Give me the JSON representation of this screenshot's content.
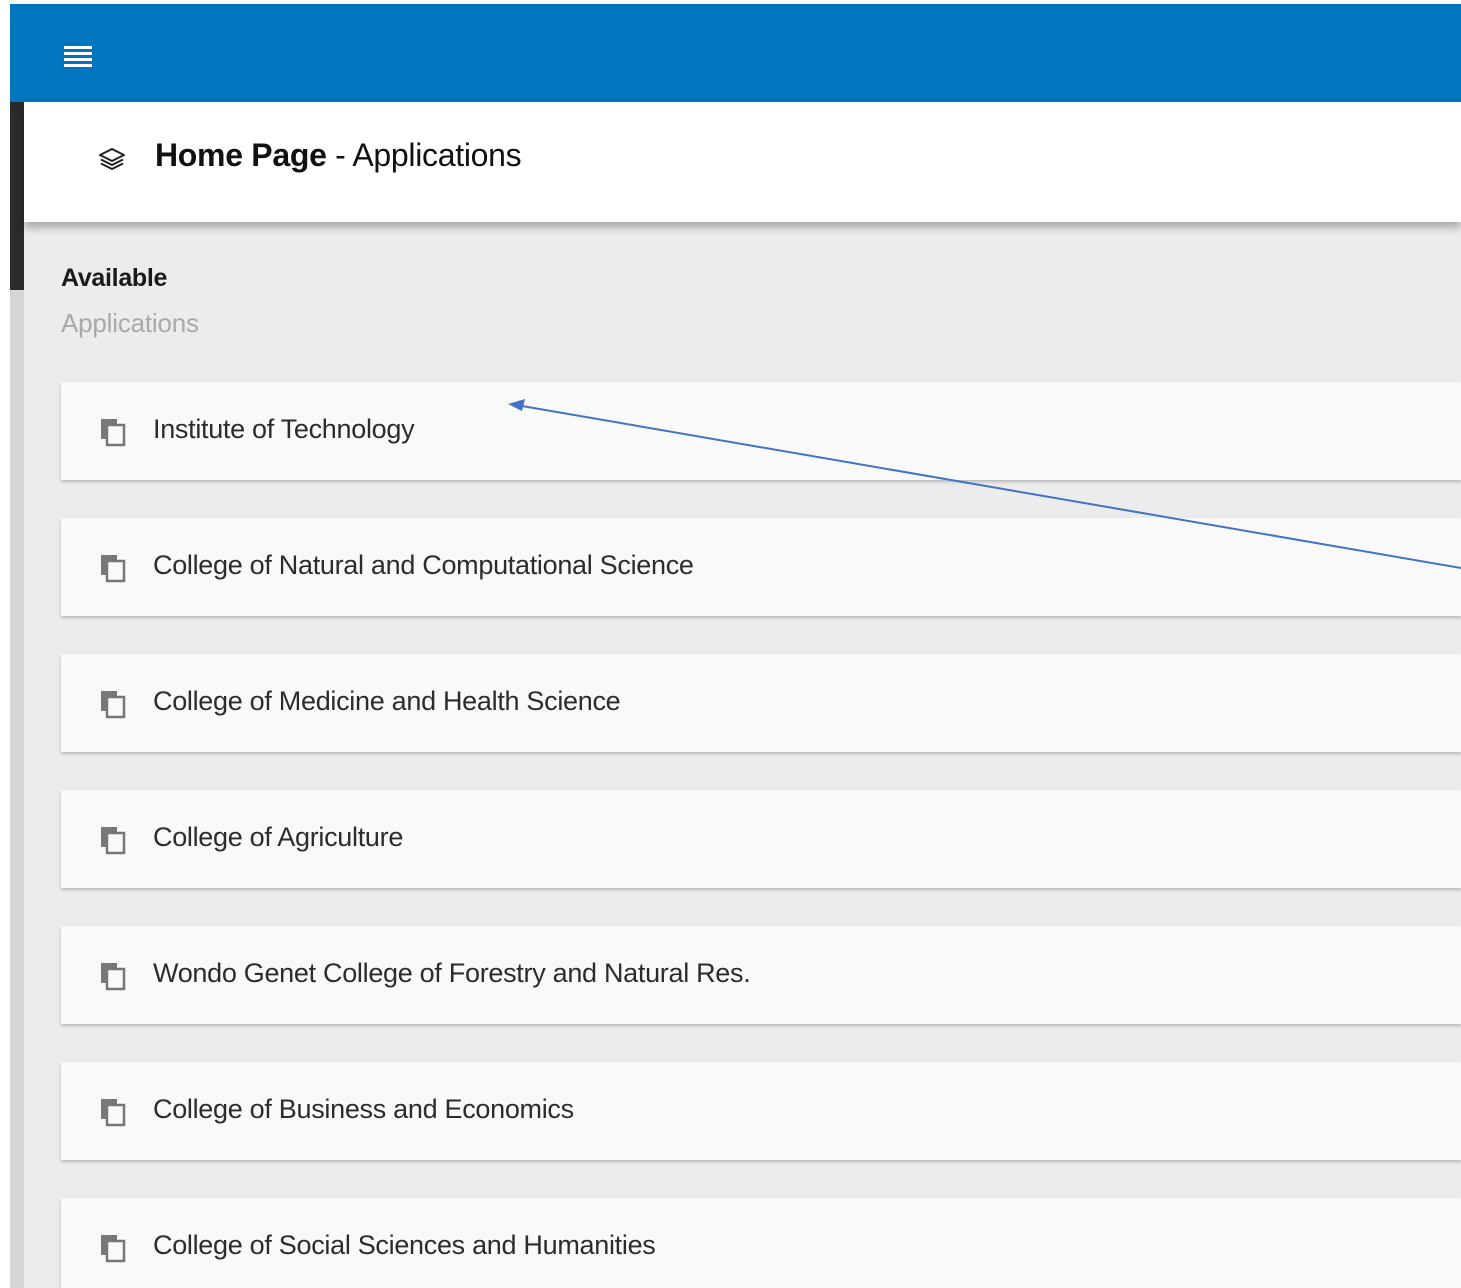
{
  "topbar": {
    "menu_icon": "hamburger-menu-icon",
    "color": "#0176be"
  },
  "header": {
    "icon": "layers-icon",
    "title_strong": "Home Page",
    "title_separator": " - ",
    "title_rest": "Applications"
  },
  "section": {
    "title": "Available",
    "subtitle": "Applications"
  },
  "applications": [
    {
      "label": "Institute of Technology",
      "icon": "copy-icon"
    },
    {
      "label": "College of Natural and Computational Science",
      "icon": "copy-icon"
    },
    {
      "label": "College of Medicine and Health Science",
      "icon": "copy-icon"
    },
    {
      "label": "College of Agriculture",
      "icon": "copy-icon"
    },
    {
      "label": "Wondo Genet College of Forestry and Natural Res.",
      "icon": "copy-icon"
    },
    {
      "label": "College of Business and Economics",
      "icon": "copy-icon"
    },
    {
      "label": "College of Social Sciences and Humanities",
      "icon": "copy-icon"
    }
  ],
  "annotation": {
    "type": "arrow",
    "color": "#4472c4",
    "points_to": "Institute of Technology"
  }
}
